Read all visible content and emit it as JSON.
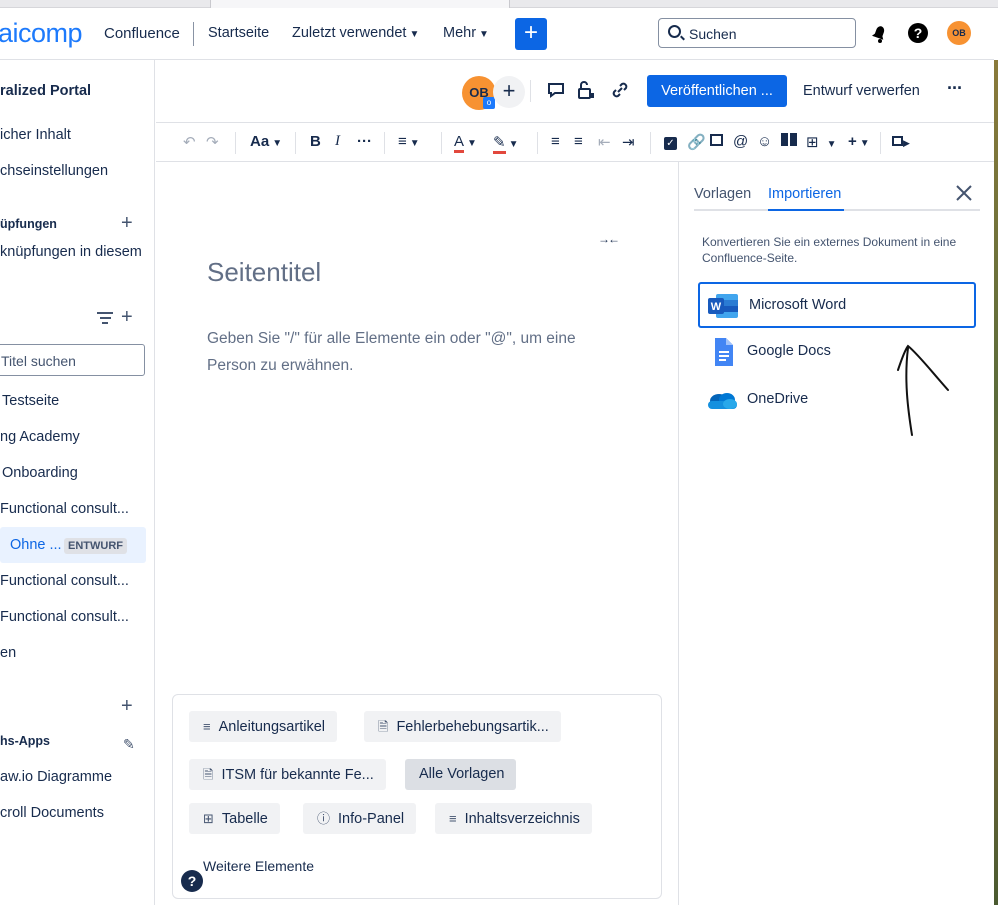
{
  "topnav": {
    "logo": "aicomp",
    "product": "Confluence",
    "items": [
      {
        "label": "Startseite",
        "chevron": false
      },
      {
        "label": "Zuletzt verwendet",
        "chevron": true
      },
      {
        "label": "Mehr",
        "chevron": true
      }
    ],
    "create_label": "+",
    "search_placeholder": "Suchen",
    "help_label": "?",
    "avatar": "OB"
  },
  "sidebar": {
    "space_title": "ralized Portal",
    "items_top": [
      "icher Inhalt",
      "chseinstellungen"
    ],
    "links_heading": "üpfungen",
    "links_text": "knüpfungen in diesem",
    "search_placeholder": "Titel suchen",
    "pages": [
      "Testseite",
      "ng Academy",
      "Onboarding",
      "Functional consult..."
    ],
    "active_page": {
      "label": "Ohne ...",
      "badge": "ENTWURF"
    },
    "pages_after": [
      "Functional consult...",
      "Functional consult...",
      "en"
    ],
    "apps_heading": "hs-Apps",
    "apps": [
      "aw.io Diagramme",
      "croll Documents"
    ]
  },
  "editor_header": {
    "collaborator": "OB",
    "collaborator_badge": "o",
    "publish_label": "Veröffentlichen ...",
    "discard_label": "Entwurf verwerfen",
    "more_label": "···"
  },
  "toolbar": {
    "text_style": "Aa",
    "bold": "B",
    "italic": "I",
    "more": "···"
  },
  "editor": {
    "title_placeholder": "Seitentitel",
    "body_placeholder": "Geben Sie \"/\" für alle Elemente ein oder \"@\", um eine Person zu erwähnen.",
    "templates": [
      {
        "label": "Anleitungsartikel",
        "icon": "list-icon"
      },
      {
        "label": "Fehlerbehebungsartik...",
        "icon": "document-icon"
      },
      {
        "label": "ITSM für bekannte Fe...",
        "icon": "document-icon"
      },
      {
        "label": "Alle Vorlagen",
        "icon": ""
      },
      {
        "label": "Tabelle",
        "icon": "table-icon"
      },
      {
        "label": "Info-Panel",
        "icon": "info-icon"
      },
      {
        "label": "Inhaltsverzeichnis",
        "icon": "list-icon"
      }
    ],
    "more_elements": "Weitere Elemente"
  },
  "right_panel": {
    "tabs": [
      "Vorlagen",
      "Importieren"
    ],
    "active_tab": "Importieren",
    "description": "Konvertieren Sie ein externes Dokument in eine Confluence-Seite.",
    "sources": [
      {
        "label": "Microsoft Word",
        "icon": "word-icon",
        "selected": true
      },
      {
        "label": "Google Docs",
        "icon": "google-docs-icon",
        "selected": false
      },
      {
        "label": "OneDrive",
        "icon": "onedrive-icon",
        "selected": false
      }
    ]
  },
  "colors": {
    "primary": "#0c66e4",
    "text": "#172b4d",
    "subtle": "#626f86",
    "avatar": "#f79232",
    "selected_bg": "#e9f2ff"
  }
}
